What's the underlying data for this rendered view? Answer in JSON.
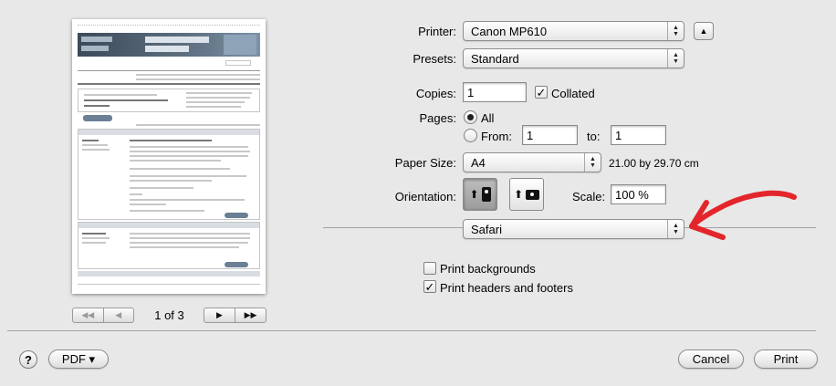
{
  "printer": {
    "label": "Printer:",
    "value": "Canon MP610"
  },
  "presets": {
    "label": "Presets:",
    "value": "Standard"
  },
  "copies": {
    "label": "Copies:",
    "value": "1",
    "collated_label": "Collated",
    "collated_checked": true
  },
  "pages": {
    "label": "Pages:",
    "all_label": "All",
    "all_selected": true,
    "from_label": "From:",
    "from_value": "1",
    "to_label": "to:",
    "to_value": "1"
  },
  "paper_size": {
    "label": "Paper Size:",
    "value": "A4",
    "dimensions": "21.00 by 29.70 cm"
  },
  "orientation": {
    "label": "Orientation:",
    "selected": "portrait"
  },
  "scale": {
    "label": "Scale:",
    "value": "100 %"
  },
  "section_popup": {
    "value": "Safari"
  },
  "options": {
    "print_backgrounds": {
      "label": "Print backgrounds",
      "checked": false
    },
    "print_headers_footers": {
      "label": "Print headers and footers",
      "checked": true
    }
  },
  "preview": {
    "page_indicator": "1 of 3"
  },
  "footer": {
    "help_label": "?",
    "pdf_label": "PDF ▾",
    "cancel_label": "Cancel",
    "print_label": "Print"
  },
  "icons": {
    "check": "✓",
    "popup_arrows_up": "▲",
    "popup_arrows_down": "▼",
    "disclosure": "▲",
    "first_page": "◀◀",
    "prev_page": "◀",
    "next_page": "▶",
    "last_page": "▶▶",
    "orient_arrow": "⬆"
  },
  "annotation": {
    "arrow_color": "#e3262b"
  }
}
